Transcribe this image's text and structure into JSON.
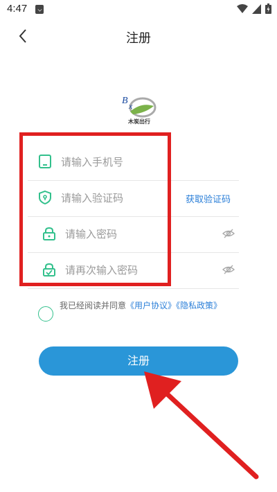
{
  "status_bar": {
    "time": "4:47"
  },
  "header": {
    "title": "注册"
  },
  "logo": {
    "text": "木炭出行"
  },
  "form": {
    "phone_placeholder": "请输入手机号",
    "code_placeholder": "请输入验证码",
    "get_code_label": "获取验证码",
    "password_placeholder": "请输入密码",
    "confirm_placeholder": "请再次输入密码"
  },
  "agreement": {
    "prefix": "我已经阅读并同意",
    "user_agreement": "《用户协议》",
    "privacy_policy": "《隐私政策》"
  },
  "register_button": {
    "label": "注册"
  },
  "colors": {
    "accent_blue": "#2a96d8",
    "link_blue": "#2b7fd8",
    "icon_green": "#32c08c",
    "highlight_red": "#e02020"
  }
}
